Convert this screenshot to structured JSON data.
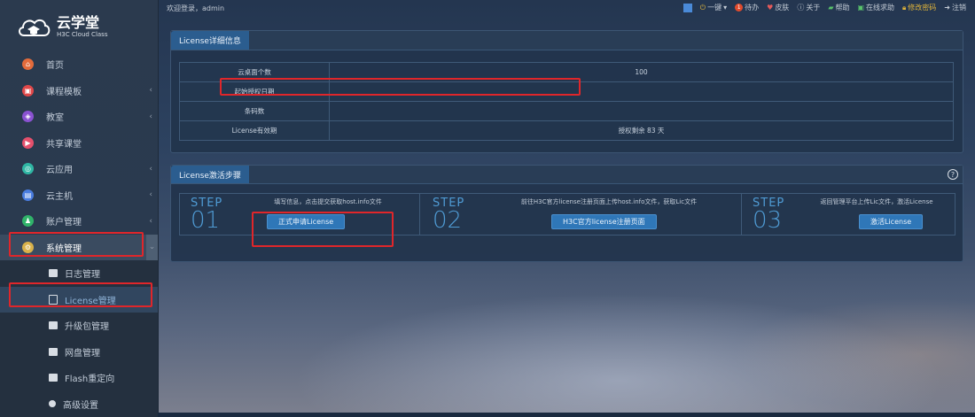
{
  "topbar": {
    "welcome": "欢迎登录，admin",
    "items": [
      {
        "label": "一键"
      },
      {
        "label": "待办",
        "badge": "1"
      },
      {
        "label": "皮肤"
      },
      {
        "label": "关于"
      },
      {
        "label": "帮助"
      },
      {
        "label": "在线求助"
      },
      {
        "label": "修改密码"
      },
      {
        "label": "注销"
      }
    ]
  },
  "logo": {
    "title": "云学堂",
    "subtitle": "H3C Cloud Class"
  },
  "sidebar": {
    "items": [
      {
        "label": "首页",
        "color": "#e36b3b",
        "glyph": "⌂",
        "chevron": false
      },
      {
        "label": "课程模板",
        "color": "#e0484a",
        "glyph": "▣",
        "chevron": true
      },
      {
        "label": "教室",
        "color": "#8a52d1",
        "glyph": "◈",
        "chevron": true
      },
      {
        "label": "共享课堂",
        "color": "#e5506c",
        "glyph": "▶",
        "chevron": false
      },
      {
        "label": "云应用",
        "color": "#2fb6a4",
        "glyph": "◎",
        "chevron": true
      },
      {
        "label": "云主机",
        "color": "#4a7de0",
        "glyph": "▤",
        "chevron": true
      },
      {
        "label": "账户管理",
        "color": "#30b36a",
        "glyph": "♟",
        "chevron": true
      },
      {
        "label": "系统管理",
        "color": "#d8b14a",
        "glyph": "⚙",
        "chevron": true
      }
    ],
    "subitems": [
      {
        "label": "日志管理"
      },
      {
        "label": "License管理"
      },
      {
        "label": "升级包管理"
      },
      {
        "label": "网盘管理"
      },
      {
        "label": "Flash重定向"
      },
      {
        "label": "高级设置"
      }
    ]
  },
  "license_panel": {
    "tab": "License详细信息",
    "rows": [
      {
        "key": "云桌面个数",
        "value": "100"
      },
      {
        "key": "起始授权日期",
        "value": ""
      },
      {
        "key": "条码数",
        "value": ""
      },
      {
        "key": "License有效期",
        "value": "授权剩余 83 天"
      }
    ]
  },
  "steps_panel": {
    "tab": "License激活步骤",
    "steps": [
      {
        "word": "STEP",
        "digit": "01",
        "desc": "填写信息，点击提交获取host.info文件",
        "button": "正式申请License"
      },
      {
        "word": "STEP",
        "digit": "02",
        "desc": "前往H3C官方license注册页面上传host.info文件，获取Lic文件",
        "button": "H3C官方license注册页面"
      },
      {
        "word": "STEP",
        "digit": "03",
        "desc": "返回管理平台上传Lic文件，激活License",
        "button": "激活License"
      }
    ]
  },
  "colors": {
    "accent": "#2f77b8",
    "highlight": "#e0262a",
    "step": "#4f9bd4"
  }
}
